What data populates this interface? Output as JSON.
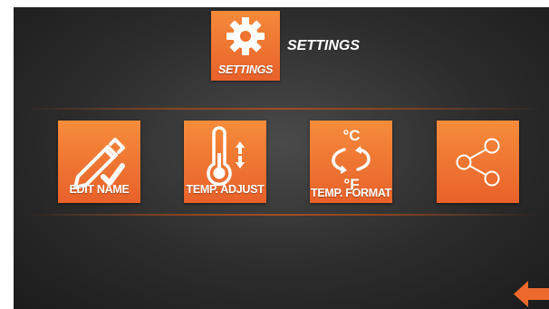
{
  "header": {
    "icon_label": "SETTINGS",
    "title": "SETTINGS",
    "icon": "gear-icon"
  },
  "tiles": [
    {
      "label": "EDIT NAME",
      "icon": "pencil-check-icon"
    },
    {
      "label": "TEMP. ADJUST",
      "icon": "thermometer-icon"
    },
    {
      "label": "TEMP. FORMAT",
      "icon": "temp-format-icon",
      "top_unit": "°C",
      "bottom_unit": "°F"
    },
    {
      "label": "",
      "icon": "share-icon"
    }
  ],
  "navigation": {
    "back_icon": "back-arrow-icon"
  },
  "colors": {
    "accent_orange": "#e8612a",
    "accent_orange_light": "#f68c3b",
    "background_dark": "#2c2c2c",
    "text": "#ffffff",
    "divider": "#a14f22"
  }
}
